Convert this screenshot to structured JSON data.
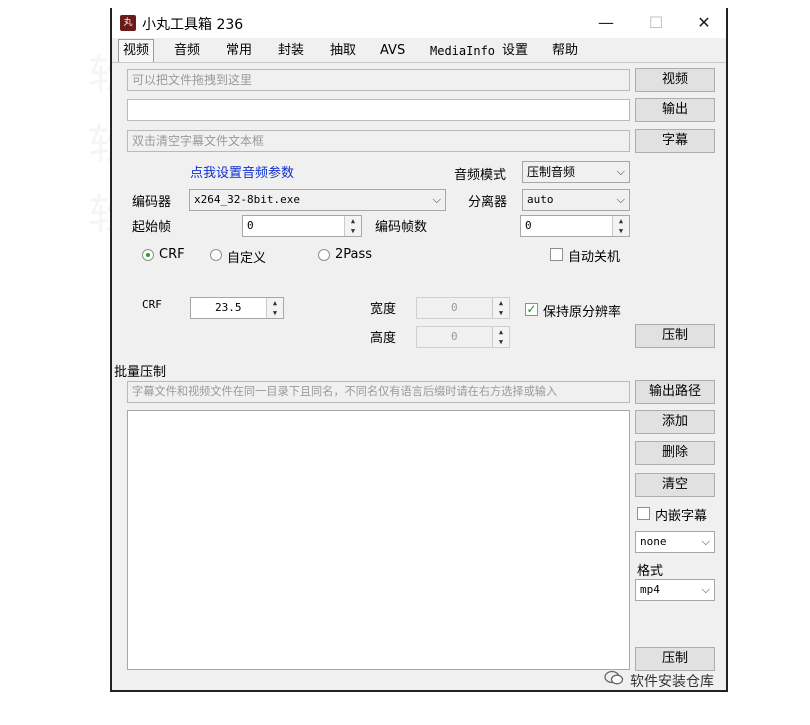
{
  "window": {
    "title": "小丸工具箱 236",
    "icon_label": "丸",
    "minimize_glyph": "—",
    "maximize_glyph": "☐",
    "close_glyph": "✕"
  },
  "tabs": [
    "视频",
    "音频",
    "常用",
    "封装",
    "抽取",
    "AVS",
    "MediaInfo",
    "设置",
    "帮助"
  ],
  "inputs": {
    "video_placeholder": "可以把文件拖拽到这里",
    "output_value": "",
    "subtitle_placeholder": "双击清空字幕文件文本框"
  },
  "buttons": {
    "video": "视频",
    "output": "输出",
    "subtitle": "字幕",
    "compress_top": "压制",
    "output_path": "输出路径",
    "add": "添加",
    "delete": "删除",
    "clear": "清空",
    "compress_bottom": "压制"
  },
  "audio_settings_link": "点我设置音频参数",
  "audio_mode": {
    "label": "音频模式",
    "value": "压制音频"
  },
  "encoder": {
    "label": "编码器",
    "value": "x264_32-8bit.exe"
  },
  "demuxer": {
    "label": "分离器",
    "value": "auto"
  },
  "start_frame": {
    "label": "起始帧",
    "value": "0"
  },
  "encode_frames": {
    "label": "编码帧数",
    "value": "0"
  },
  "modes": {
    "crf": "CRF",
    "custom": "自定义",
    "twopass": "2Pass",
    "selected": "CRF"
  },
  "auto_shutdown": {
    "label": "自动关机",
    "checked": false
  },
  "crf": {
    "label": "CRF",
    "value": "23.5"
  },
  "width": {
    "label": "宽度",
    "value": "0"
  },
  "height": {
    "label": "高度",
    "value": "0"
  },
  "keep_resolution": {
    "label": "保持原分辨率",
    "checked": true,
    "check_glyph": "✓"
  },
  "batch": {
    "label": "批量压制",
    "hint": "字幕文件和视频文件在同一目录下且同名，不同名仅有语言后缀时请在右方选择或输入"
  },
  "embed_subtitles": {
    "label": "内嵌字幕",
    "checked": false
  },
  "subtitle_lang": {
    "value": "none"
  },
  "format": {
    "label": "格式",
    "value": "mp4"
  },
  "watermark": {
    "text": "软件安装仓库"
  },
  "signature": {
    "text": "软件安装仓库",
    "icon": "wechat-icon"
  },
  "colors": {
    "link": "#0f2fcf",
    "radio_dot": "#2aa32a",
    "check": "#1a8a1a",
    "window_bg": "#f0f0f0"
  }
}
